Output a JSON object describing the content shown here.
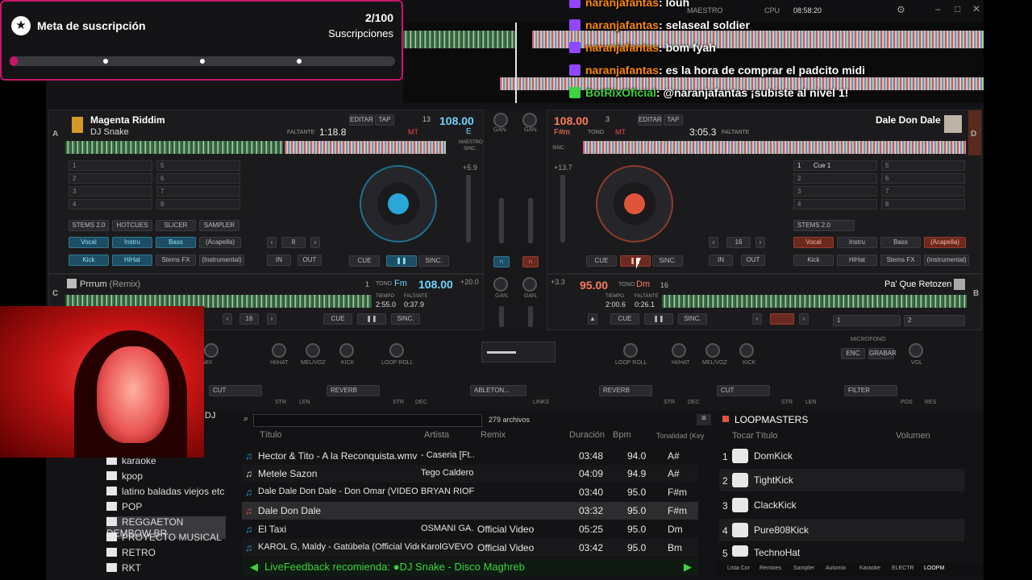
{
  "goal": {
    "title": "Meta de suscripción",
    "count": "2/100",
    "subtitle": "Suscripciones",
    "progress": 0.02
  },
  "chat": [
    {
      "user": "naranjafantas",
      "message": ": louh",
      "bot": false
    },
    {
      "user": "naranjafantas",
      "message": ": selaseal soldier",
      "bot": false
    },
    {
      "user": "naranjafantas",
      "message": ": bom fyah",
      "bot": false
    },
    {
      "user": "naranjafantas",
      "message": ": es la hora de comprar el padcito midi",
      "bot": false
    },
    {
      "user": "BotRixOficial",
      "message": ": @naranjafantas ¡subiste al nivel 1!",
      "bot": true
    }
  ],
  "topbar": {
    "maestro": "MAESTRO",
    "cpu": "CPU",
    "time": "08:58:20"
  },
  "deckA": {
    "letter": "A",
    "title": "Magenta Riddim",
    "artist": "DJ Snake",
    "remaining_label": "FALTANTE",
    "remaining": "1:18.8",
    "bpm": "108.00",
    "key": "E",
    "mt": "MT",
    "beat": "13",
    "sync_label": "SINC.",
    "master_label": "MAESTRO",
    "edit": "EDITAR",
    "tap": "TAP",
    "loop": "8",
    "pitch": "+5.9",
    "hotcues": [
      "1",
      "2",
      "3",
      "4",
      "5",
      "6",
      "7",
      "8"
    ],
    "stems_tabs": [
      "STEMS 2.0",
      "HOTCUES",
      "SLICER",
      "SAMPLER"
    ],
    "stems": [
      "Vocal",
      "Instru",
      "Bass",
      "(Acapella)",
      "Kick",
      "HiHat",
      "Stems FX",
      "(Instrumental)"
    ],
    "cue": "CUE",
    "sync": "SINC.",
    "in": "IN",
    "out": "OUT"
  },
  "deckB": {
    "letter": "D",
    "title": "Dale Don Dale",
    "remaining_label": "FALTANTE",
    "remaining": "3:05.3",
    "bpm": "108.00",
    "key": "F#m",
    "tono": "TONO",
    "mt": "MT",
    "beat": "3",
    "sync_label": "SINC.",
    "edit": "EDITAR",
    "tap": "TAP",
    "loop": "16",
    "pitch": "+13.7",
    "cue1": "Cue 1",
    "hotcues": [
      "1",
      "2",
      "3",
      "4",
      "5",
      "6",
      "7",
      "8"
    ],
    "stems_select": "STEMS 2.0",
    "stems": [
      "Vocal",
      "Instru",
      "Bass",
      "(Acapella)",
      "Kick",
      "HiHat",
      "Stems FX",
      "(Instrumental)"
    ],
    "cue": "CUE",
    "sync": "SINC.",
    "in": "IN",
    "out": "OUT"
  },
  "deckC": {
    "letter": "C",
    "title": "Prrrum",
    "suffix": "(Remix)",
    "bpm": "108.00",
    "key": "Fm",
    "tono": "TONO",
    "beat": "1",
    "tiempo_label": "TIEMPO",
    "tiempo": "2:55.0",
    "faltante_label": "FALTANTE",
    "faltante": "0:37.9",
    "pitch": "+20.0",
    "loop": "16",
    "cue": "CUE",
    "sync": "SINC."
  },
  "deckD": {
    "letter": "B",
    "title": "Pa' Que Retozen",
    "bpm": "95.00",
    "key": "Dm",
    "tono": "TONO",
    "beat": "16",
    "tiempo_label": "TIEMPO",
    "tiempo": "2:00.6",
    "faltante_label": "FALTANTE",
    "faltante": "0:26.1",
    "pitch": "+3.3",
    "cue": "CUE",
    "sync": "SINC.",
    "pads": [
      "1",
      "2"
    ]
  },
  "mixer": {
    "gain": "GAN.",
    "labels": [
      "MIX",
      "HI/HAT",
      "MEL/VOZ",
      "KICK",
      "LOOP ROLL",
      "LOOP ROLL",
      "HI/HAT",
      "MEL/VOZ",
      "KICK"
    ],
    "fx_left": [
      "CUT",
      "REVERB"
    ],
    "fx_left_knobs": [
      "STR",
      "LEN",
      "STR",
      "DEC"
    ],
    "fx_center": "ABLETON...",
    "links": "LINKS",
    "fx_right": [
      "REVERB",
      "CUT",
      "FILTER"
    ],
    "fx_right_knobs": [
      "STR",
      "DEC",
      "STR",
      "LEN",
      "POS",
      "RES"
    ],
    "mic_label": "MICRÓFONO",
    "enc": "ENC",
    "grabar": "GRABAR",
    "vol": "VOL"
  },
  "browser": {
    "search_placeholder": "",
    "file_count": "279 archivos",
    "columns": [
      "Título",
      "Artista",
      "Remix",
      "Duración",
      "Bpm",
      "Tonalidad (Key"
    ],
    "folders": [
      "karaoke",
      "kpop",
      "latino baladas viejos etc",
      "POP",
      "REGGAETON DEMBOW BR",
      "PROYECTO MUSICAL",
      "RETRO",
      "RKT"
    ],
    "dj_label": "DJ",
    "rows": [
      {
        "title": "Hector & Tito - A la Reconquista.wmv",
        "artist": "- Caseria [Ft...",
        "remix": "",
        "duration": "03:48",
        "bpm": "94.0",
        "key": "A#"
      },
      {
        "title": "Metele Sazon",
        "artist": "Tego Calderon",
        "remix": "",
        "duration": "04:09",
        "bpm": "94.9",
        "key": "A#"
      },
      {
        "title": "Dale Dale Don Dale - Don Omar (VIDEO OFFIC...",
        "artist": "BRYAN RIOF...",
        "remix": "",
        "duration": "03:40",
        "bpm": "95.0",
        "key": "F#m"
      },
      {
        "title": "Dale Don Dale",
        "artist": "",
        "remix": "",
        "duration": "03:32",
        "bpm": "95.0",
        "key": "F#m"
      },
      {
        "title": "El Taxi",
        "artist": "OSMANI GA...",
        "remix": "Official Video",
        "duration": "05:25",
        "bpm": "95.0",
        "key": "Dm"
      },
      {
        "title": "KAROL G, Maldy - Gatúbela (Official Video)",
        "artist": "KarolGVEVO",
        "remix": "Official Video",
        "duration": "03:42",
        "bpm": "95.0",
        "key": "Bm"
      }
    ],
    "feedback": "LiveFeedback recomienda: ●DJ Snake - Disco Maghreb"
  },
  "sampler": {
    "title": "LOOPMASTERS",
    "col_play": "Tocar",
    "col_title": "Título",
    "col_volume": "Volumen",
    "items": [
      "DomKick",
      "TightKick",
      "ClackKick",
      "Pure808Kick",
      "TechnoHat"
    ],
    "tabs": [
      "Lista Cor",
      "Remixes",
      "Sampler",
      "Automix",
      "Karaoke",
      "ELECTR",
      "LOOPM"
    ]
  },
  "colors": {
    "accent": "#c7166b",
    "deck_left": "#2aa6d8",
    "deck_right": "#e0553a",
    "chat_user": "#ff8a00",
    "chat_bot": "#3fd13f"
  }
}
